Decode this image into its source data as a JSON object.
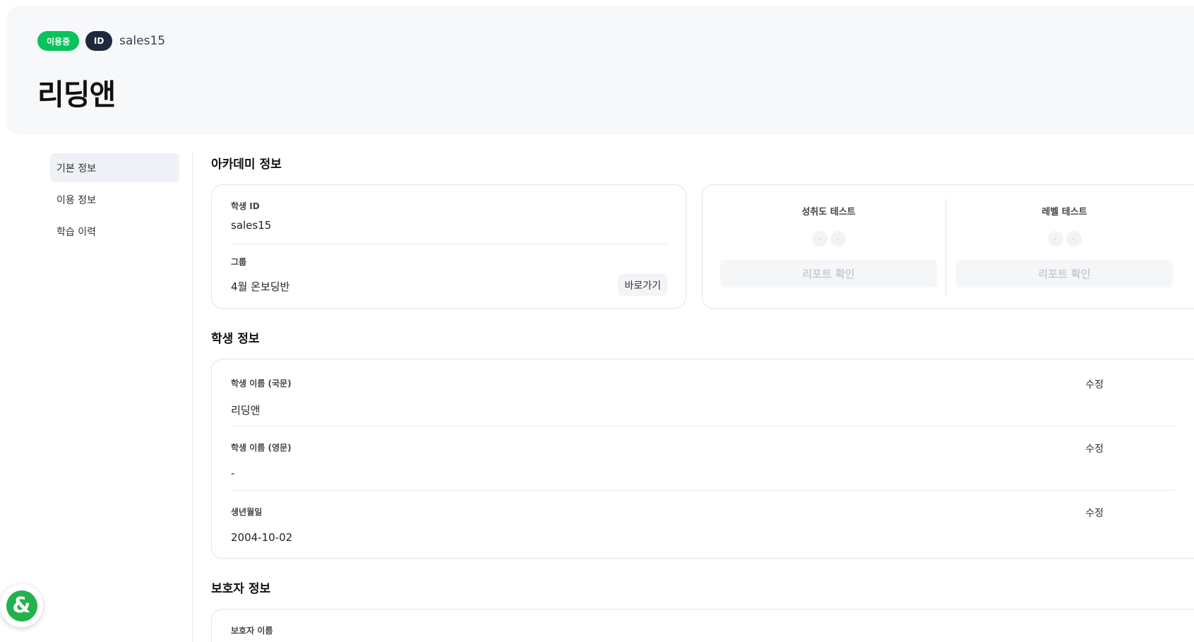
{
  "header": {
    "status_badge": "이용중",
    "id_badge": "ID",
    "username": "sales15",
    "title": "리딩앤"
  },
  "sidebar": {
    "items": [
      {
        "label": "기본 정보",
        "active": true
      },
      {
        "label": "이용 정보",
        "active": false
      },
      {
        "label": "학습 이력",
        "active": false
      }
    ]
  },
  "academy": {
    "section_title": "아카데미 정보",
    "student_id_label": "학생 ID",
    "student_id_value": "sales15",
    "group_label": "그룹",
    "group_value": "4월 온보딩반",
    "goto_label": "바로가기",
    "tests": [
      {
        "title": "성취도 테스트",
        "dots": [
          "-",
          "-"
        ],
        "report_label": "리포트 확인"
      },
      {
        "title": "레벨 테스트",
        "dots": [
          "-",
          "-"
        ],
        "report_label": "리포트 확인"
      }
    ]
  },
  "student": {
    "section_title": "학생 정보",
    "fields": [
      {
        "label": "학생 이름 (국문)",
        "value": "리딩앤",
        "edit": "수정"
      },
      {
        "label": "학생 이름 (영문)",
        "value": "-",
        "edit": "수정"
      },
      {
        "label": "생년월일",
        "value": "2004-10-02",
        "edit": "수정"
      }
    ]
  },
  "guardian": {
    "section_title": "보호자 정보",
    "name_label": "보호자 이름"
  },
  "fab": {
    "icon": "ampersand-chat-icon",
    "symbol": "&",
    "color": "#22b24c"
  },
  "colors": {
    "status_green": "#08c35a",
    "id_dark": "#1e293b",
    "header_bg": "#f7f8fa"
  }
}
